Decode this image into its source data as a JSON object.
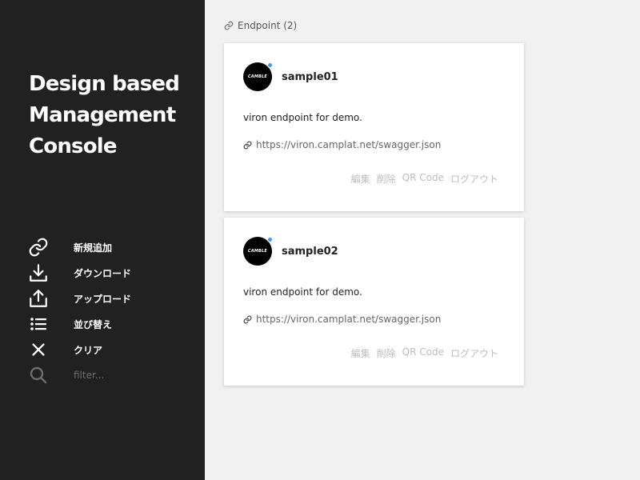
{
  "sidebar": {
    "brand_lines": [
      "Design based",
      "Management",
      "Console"
    ],
    "menu": [
      {
        "label": "新規追加",
        "icon": "link-icon"
      },
      {
        "label": "ダウンロード",
        "icon": "download-icon"
      },
      {
        "label": "アップロード",
        "icon": "upload-icon"
      },
      {
        "label": "並び替え",
        "icon": "sort-list-icon"
      },
      {
        "label": "クリア",
        "icon": "close-icon"
      }
    ],
    "filter": {
      "placeholder": "filter...",
      "value": "",
      "icon": "search-icon"
    }
  },
  "main": {
    "header": {
      "label": "Endpoint (2)",
      "icon": "link-icon"
    },
    "cards": [
      {
        "name": "sample01",
        "avatar_text": "CAMBLE",
        "description": "viron endpoint for demo.",
        "url": "https://viron.camplat.net/swagger.json",
        "actions": [
          "編集",
          "削除",
          "QR Code",
          "ログアウト"
        ]
      },
      {
        "name": "sample02",
        "avatar_text": "CAMBLE",
        "description": "viron endpoint for demo.",
        "url": "https://viron.camplat.net/swagger.json",
        "actions": [
          "編集",
          "削除",
          "QR Code",
          "ログアウト"
        ]
      }
    ]
  },
  "colors": {
    "sidebar_bg": "#212121",
    "main_bg": "#f1f1f1",
    "status_dot": "#3b9cf2",
    "action_text": "#bdbdbd"
  }
}
